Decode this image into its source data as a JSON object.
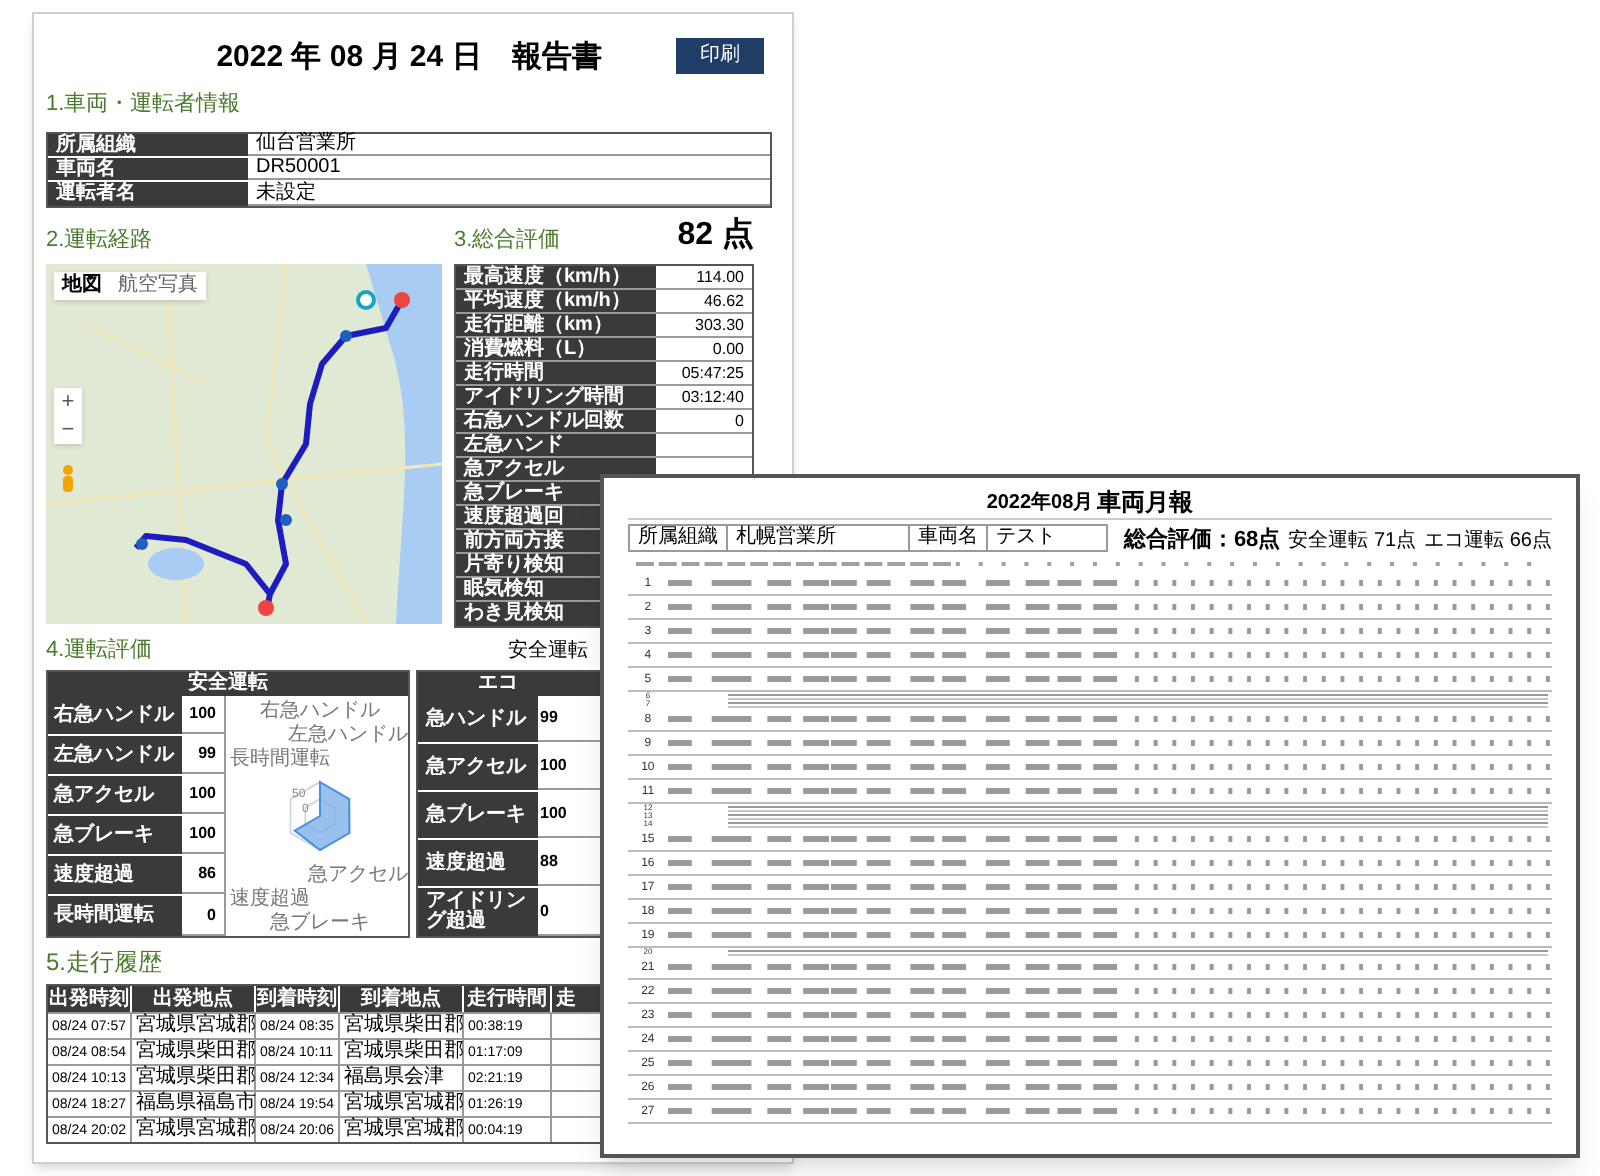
{
  "daily_report": {
    "title": "2022 年 08 月 24 日　報告書",
    "print_button": "印刷",
    "section_1": "1.車両・運転者情報",
    "info": [
      {
        "label": "所属組織",
        "value": "仙台営業所"
      },
      {
        "label": "車両名",
        "value": "DR50001"
      },
      {
        "label": "運転者名",
        "value": "未設定"
      }
    ],
    "section_2": "2.運転経路",
    "map": {
      "map_types": [
        {
          "label": "地図",
          "selected": true
        },
        {
          "label": "航空写真",
          "selected": false
        }
      ],
      "zoom_in": "+",
      "zoom_out": "−"
    },
    "section_3": "3.総合評価",
    "score": "82 点",
    "summary": [
      {
        "label": "最高速度（km/h）",
        "value": "114.00"
      },
      {
        "label": "平均速度（km/h）",
        "value": "46.62"
      },
      {
        "label": "走行距離（km）",
        "value": "303.30"
      },
      {
        "label": "消費燃料（L）",
        "value": "0.00"
      },
      {
        "label": "走行時間",
        "value": "05:47:25"
      },
      {
        "label": "アイドリング時間",
        "value": "03:12:40"
      },
      {
        "label": "右急ハンドル回数",
        "value": "0"
      },
      {
        "label": "左急ハンド"
      },
      {
        "label": "急アクセル"
      },
      {
        "label": "急ブレーキ"
      },
      {
        "label": "速度超過回"
      },
      {
        "label": "前方両方接"
      },
      {
        "label": "片寄り検知"
      },
      {
        "label": "眠気検知"
      },
      {
        "label": "わき見検知"
      }
    ],
    "section_4": "4.運転評価",
    "legend": "安全運転",
    "safety": {
      "header": "安全運転",
      "rows": [
        {
          "label": "右急ハンドル",
          "value": "100"
        },
        {
          "label": "左急ハンドル",
          "value": "99"
        },
        {
          "label": "急アクセル",
          "value": "100"
        },
        {
          "label": "急ブレーキ",
          "value": "100"
        },
        {
          "label": "速度超過",
          "value": "86"
        },
        {
          "label": "長時間運転",
          "value": "0"
        }
      ],
      "radar_axes": [
        "右急ハンドル",
        "左急ハンドル",
        "長時間運転",
        "急アクセル",
        "速度超過",
        "急ブレーキ"
      ],
      "radar_ticks": [
        "50",
        "0"
      ]
    },
    "eco": {
      "header": "エコ",
      "rows": [
        {
          "label": "急ハンドル",
          "value": "99"
        },
        {
          "label": "急アクセル",
          "value": "100"
        },
        {
          "label": "急ブレーキ",
          "value": "100"
        },
        {
          "label": "速度超過",
          "value": "88"
        },
        {
          "label": "アイドリング超過",
          "value": "0"
        }
      ]
    },
    "section_5": "5.走行履歴",
    "history": {
      "columns": [
        "出発時刻",
        "出発地点",
        "到着時刻",
        "到着地点",
        "走行時間",
        "走"
      ],
      "rows": [
        [
          "08/24 07:57",
          "宮城県宮城郡",
          "08/24 08:35",
          "宮城県柴田郡",
          "00:38:19"
        ],
        [
          "08/24 08:54",
          "宮城県柴田郡",
          "08/24 10:11",
          "宮城県柴田郡",
          "01:17:09"
        ],
        [
          "08/24 10:13",
          "宮城県柴田郡",
          "08/24 12:34",
          "福島県会津",
          "02:21:19"
        ],
        [
          "08/24 18:27",
          "福島県福島市",
          "08/24 19:54",
          "宮城県宮城郡",
          "01:26:19"
        ],
        [
          "08/24 20:02",
          "宮城県宮城郡",
          "08/24 20:06",
          "宮城県宮城郡",
          "00:04:19"
        ]
      ]
    }
  },
  "monthly_report": {
    "title_date": "2022年08月",
    "title": "車両月報",
    "org_label": "所属組織",
    "org": "札幌営業所",
    "vehicle_label": "車両名",
    "vehicle": "テスト",
    "total": "総合評価：68点",
    "safety": "安全運転 71点",
    "eco": "エコ運転 66点",
    "rows": [
      {
        "no": "1",
        "kind": "data"
      },
      {
        "no": "2",
        "kind": "data"
      },
      {
        "no": "3",
        "kind": "data"
      },
      {
        "no": "4",
        "kind": "data"
      },
      {
        "no": "5",
        "kind": "data"
      },
      {
        "no": "6",
        "kind": "empty"
      },
      {
        "no": "7",
        "kind": "empty"
      },
      {
        "no": "8",
        "kind": "data"
      },
      {
        "no": "9",
        "kind": "data"
      },
      {
        "no": "10",
        "kind": "data"
      },
      {
        "no": "11",
        "kind": "data"
      },
      {
        "no": "12",
        "kind": "empty"
      },
      {
        "no": "13",
        "kind": "empty"
      },
      {
        "no": "14",
        "kind": "empty"
      },
      {
        "no": "15",
        "kind": "data"
      },
      {
        "no": "16",
        "kind": "data"
      },
      {
        "no": "17",
        "kind": "data"
      },
      {
        "no": "18",
        "kind": "data"
      },
      {
        "no": "19",
        "kind": "data"
      },
      {
        "no": "20",
        "kind": "empty"
      },
      {
        "no": "21",
        "kind": "data"
      },
      {
        "no": "22",
        "kind": "data"
      },
      {
        "no": "23",
        "kind": "data"
      },
      {
        "no": "24",
        "kind": "data"
      },
      {
        "no": "25",
        "kind": "data"
      },
      {
        "no": "26",
        "kind": "data"
      },
      {
        "no": "27",
        "kind": "data"
      }
    ]
  }
}
